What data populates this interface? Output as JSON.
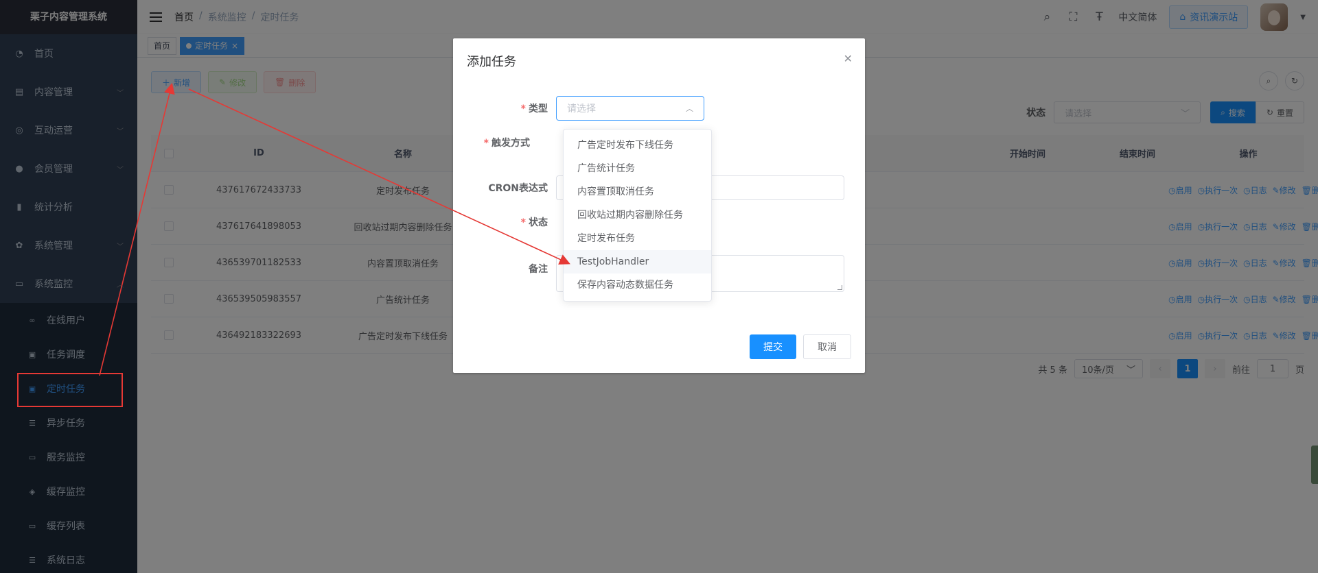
{
  "sidebar": {
    "logo": "栗子内容管理系统",
    "items": [
      {
        "label": "首页",
        "icon": "dashboard-icon"
      },
      {
        "label": "内容管理",
        "icon": "document-icon"
      },
      {
        "label": "互动运营",
        "icon": "target-icon"
      },
      {
        "label": "会员管理",
        "icon": "user-icon"
      },
      {
        "label": "统计分析",
        "icon": "bar-chart-icon"
      },
      {
        "label": "系统管理",
        "icon": "gear-icon"
      },
      {
        "label": "系统监控",
        "icon": "monitor-icon"
      }
    ],
    "sub_items": [
      {
        "label": "在线用户",
        "icon": "online-icon"
      },
      {
        "label": "任务调度",
        "icon": "job-icon"
      },
      {
        "label": "定时任务",
        "icon": "timer-icon"
      },
      {
        "label": "异步任务",
        "icon": "list-icon"
      },
      {
        "label": "服务监控",
        "icon": "server-icon"
      },
      {
        "label": "缓存监控",
        "icon": "cache-icon"
      },
      {
        "label": "缓存列表",
        "icon": "cache-list-icon"
      },
      {
        "label": "系统日志",
        "icon": "log-icon"
      }
    ]
  },
  "header": {
    "breadcrumb": [
      "首页",
      "系统监控",
      "定时任务"
    ],
    "separator": "/",
    "lang": "中文简体",
    "demo_button": "资讯演示站"
  },
  "tags": {
    "home": "首页",
    "active": "定时任务",
    "close": "×"
  },
  "toolbar": {
    "add": "新增",
    "edit": "修改",
    "delete": "删除"
  },
  "search": {
    "status_label": "状态",
    "status_placeholder": "请选择",
    "search_btn": "搜索",
    "reset_btn": "重置"
  },
  "table": {
    "headers": {
      "id": "ID",
      "name": "名称",
      "start": "开始时间",
      "end": "结束时间",
      "ops": "操作"
    },
    "rows": [
      {
        "id": "437617672433733",
        "name": "定时发布任务"
      },
      {
        "id": "437617641898053",
        "name": "回收站过期内容删除任务"
      },
      {
        "id": "436539701182533",
        "name": "内容置顶取消任务"
      },
      {
        "id": "436539505983557",
        "name": "广告统计任务"
      },
      {
        "id": "436492183322693",
        "name": "广告定时发布下线任务"
      }
    ],
    "ops": [
      "启用",
      "执行一次",
      "日志",
      "修改",
      "删除"
    ]
  },
  "pager": {
    "total": "共 5 条",
    "page_size": "10条/页",
    "current": "1",
    "goto_label": "前往",
    "goto_value": "1",
    "page_suffix": "页"
  },
  "dialog": {
    "title": "添加任务",
    "fields": {
      "type": "类型",
      "trigger": "触发方式",
      "cron": "CRON表达式",
      "status": "状态",
      "remark": "备注"
    },
    "required_mark": "*",
    "type_placeholder": "请选择",
    "submit": "提交",
    "cancel": "取消"
  },
  "dropdown": {
    "options": [
      "广告定时发布下线任务",
      "广告统计任务",
      "内容置顶取消任务",
      "回收站过期内容删除任务",
      "定时发布任务",
      "TestJobHandler",
      "保存内容动态数据任务"
    ],
    "hovered_index": 5
  },
  "colors": {
    "primary": "#1890ff",
    "sidebar_bg": "#304156",
    "annotation": "#e53935"
  }
}
